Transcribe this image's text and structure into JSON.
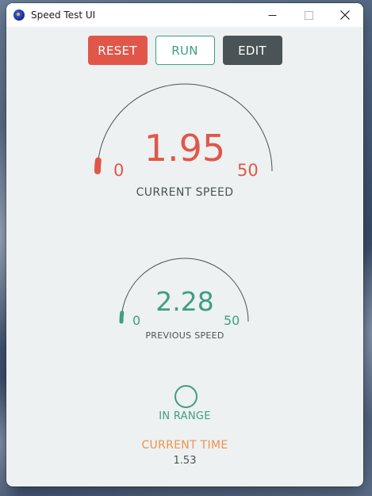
{
  "window": {
    "title": "Speed Test UI",
    "icon": "app-globe-icon"
  },
  "title_controls": {
    "minimize_icon": "minimize-icon",
    "maximize_icon": "maximize-icon",
    "close_icon": "close-icon"
  },
  "toolbar": {
    "reset_label": "RESET",
    "run_label": "RUN",
    "edit_label": "EDIT"
  },
  "current_speed": {
    "value": "1.95",
    "min_label": "0",
    "max_label": "50",
    "caption": "CURRENT SPEED",
    "fill_fraction": 0.039,
    "color": "#e0574a"
  },
  "previous_speed": {
    "value": "2.28",
    "min_label": "0",
    "max_label": "50",
    "caption": "PREVIOUS SPEED",
    "fill_fraction": 0.0456,
    "color": "#3f9d84"
  },
  "status": {
    "label": "IN RANGE",
    "color": "#3f9d84"
  },
  "time": {
    "label": "CURRENT TIME",
    "value": "1.53",
    "label_color": "#f0914a"
  },
  "colors": {
    "window_bg": "#edf1f1",
    "reset_bg": "#e0574a",
    "run_accent": "#3f9d84",
    "edit_bg": "#4a5355",
    "text_dark": "#4a5355"
  }
}
